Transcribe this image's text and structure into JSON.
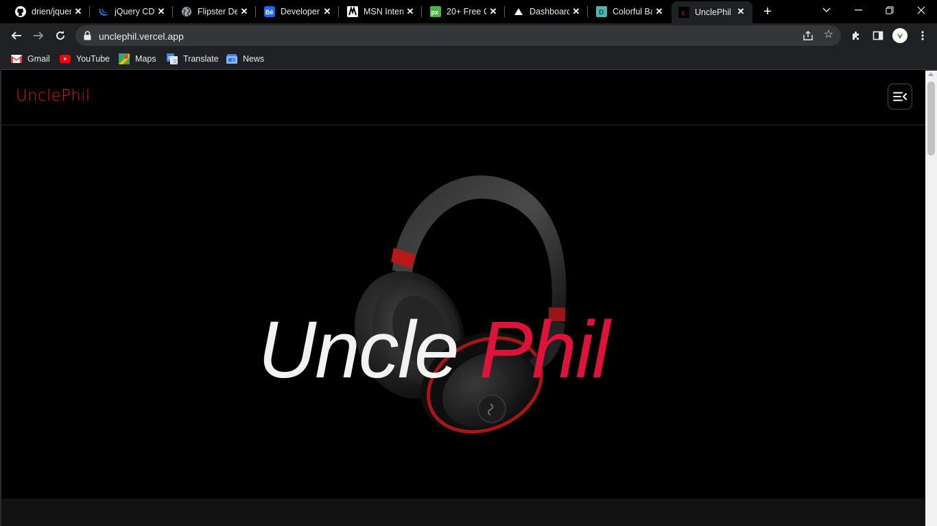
{
  "browser": {
    "tabs": [
      {
        "title": "drien/jquery",
        "favicon": "github-icon",
        "active": false
      },
      {
        "title": "jQuery CDN",
        "favicon": "jquery-icon",
        "active": false
      },
      {
        "title": "Flipster Demo",
        "favicon": "globe-icon",
        "active": false
      },
      {
        "title": "Developer",
        "favicon": "behance-icon",
        "active": false
      },
      {
        "title": "MSN Intern",
        "favicon": "msn-icon",
        "active": false
      },
      {
        "title": "20+ Free C",
        "favicon": "px-icon",
        "active": false
      },
      {
        "title": "Dashboard",
        "favicon": "vercel-icon",
        "active": false
      },
      {
        "title": "Colorful Ba",
        "favicon": "d-icon",
        "active": false
      },
      {
        "title": "UnclePhil",
        "favicon": "unclephil-icon",
        "active": true
      }
    ],
    "url": "unclephil.vercel.app",
    "bookmarks": [
      {
        "label": "Gmail",
        "icon": "gmail-icon"
      },
      {
        "label": "YouTube",
        "icon": "youtube-icon"
      },
      {
        "label": "Maps",
        "icon": "maps-icon"
      },
      {
        "label": "Translate",
        "icon": "translate-icon"
      },
      {
        "label": "News",
        "icon": "news-icon"
      }
    ]
  },
  "site": {
    "logo": "UnclePhil",
    "menu_icon": "menu-icon",
    "hero": {
      "title_part1": "Uncle",
      "title_part2": "Phil",
      "image": "headphones-image"
    }
  },
  "colors": {
    "brand_red": "#dc143c",
    "hero_white": "#f2f2f2",
    "background": "#000000"
  }
}
